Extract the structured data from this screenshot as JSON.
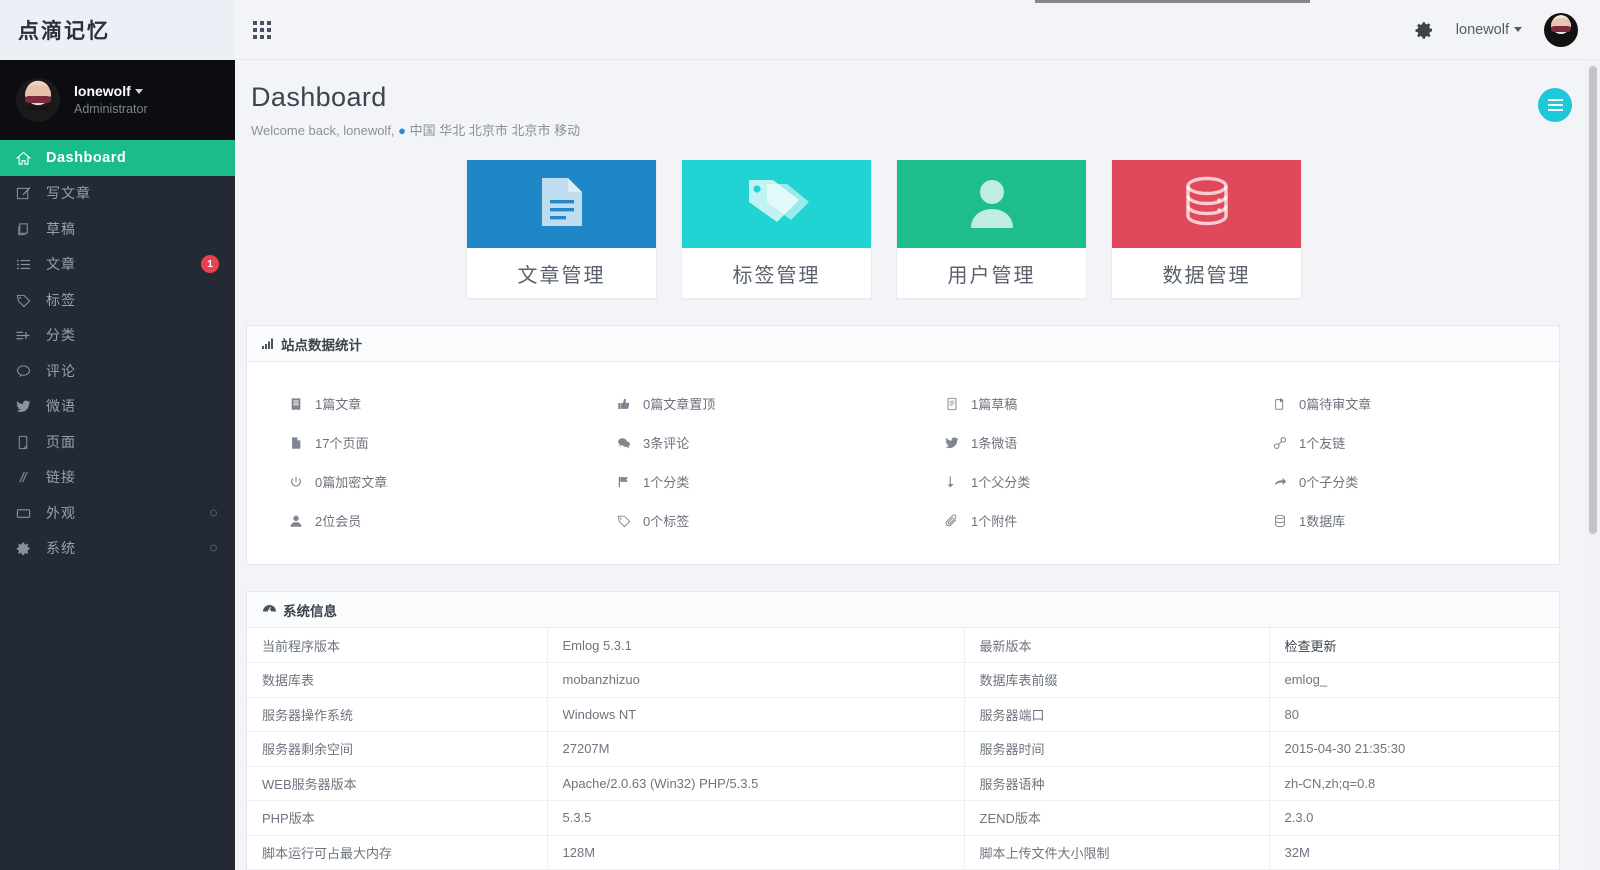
{
  "brand": {
    "title": "点滴记忆"
  },
  "sidebar": {
    "user": {
      "name": "lonewolf",
      "role": "Administrator",
      "avatar_icon": "user-avatar"
    },
    "items": [
      {
        "label": "Dashboard",
        "icon": "home-icon",
        "active": true,
        "badge": "",
        "dot": false
      },
      {
        "label": "写文章",
        "icon": "pencil-square-icon",
        "active": false,
        "badge": "",
        "dot": false
      },
      {
        "label": "草稿",
        "icon": "copy-icon",
        "active": false,
        "badge": "",
        "dot": false
      },
      {
        "label": "文章",
        "icon": "list-icon",
        "active": false,
        "badge": "1",
        "dot": false
      },
      {
        "label": "标签",
        "icon": "tag-icon",
        "active": false,
        "badge": "",
        "dot": false
      },
      {
        "label": "分类",
        "icon": "list-plus-icon",
        "active": false,
        "badge": "",
        "dot": false
      },
      {
        "label": "评论",
        "icon": "comment-icon",
        "active": false,
        "badge": "",
        "dot": false
      },
      {
        "label": "微语",
        "icon": "twitter-bird-icon",
        "active": false,
        "badge": "",
        "dot": false
      },
      {
        "label": "页面",
        "icon": "page-icon",
        "active": false,
        "badge": "",
        "dot": false
      },
      {
        "label": "链接",
        "icon": "link-slash-icon",
        "active": false,
        "badge": "",
        "dot": false
      },
      {
        "label": "外观",
        "icon": "window-icon",
        "active": false,
        "badge": "",
        "dot": true
      },
      {
        "label": "系统",
        "icon": "gear-icon",
        "active": false,
        "badge": "",
        "dot": true
      }
    ]
  },
  "topbar": {
    "apps_icon": "grid-apps-icon",
    "settings_icon": "gear-icon",
    "username": "lonewolf",
    "avatar_icon": "user-avatar"
  },
  "page": {
    "title": "Dashboard",
    "welcome_prefix": "Welcome back, lonewolf,",
    "location": "中国 华北 北京市 北京市 移动",
    "location_icon": "map-pin-icon",
    "fab_icon": "hamburger-icon"
  },
  "cards": [
    {
      "label": "文章管理",
      "icon": "document-icon",
      "color": "#1f86c8"
    },
    {
      "label": "标签管理",
      "icon": "tags-icon",
      "color": "#22d3d3"
    },
    {
      "label": "用户管理",
      "icon": "user-icon",
      "color": "#1fbd8c"
    },
    {
      "label": "数据管理",
      "icon": "database-icon",
      "color": "#e0495c"
    }
  ],
  "stats_panel": {
    "title": "站点数据统计",
    "title_icon": "bar-chart-icon",
    "items": [
      {
        "icon": "article-icon",
        "text": "1篇文章"
      },
      {
        "icon": "thumbs-up-icon",
        "text": "0篇文章置顶"
      },
      {
        "icon": "draft-icon",
        "text": "1篇草稿"
      },
      {
        "icon": "pending-icon",
        "text": "0篇待审文章"
      },
      {
        "icon": "file-icon",
        "text": "17个页面"
      },
      {
        "icon": "comments-icon",
        "text": "3条评论"
      },
      {
        "icon": "twitter-bird-icon",
        "text": "1条微语"
      },
      {
        "icon": "link-icon",
        "text": "1个友链"
      },
      {
        "icon": "power-icon",
        "text": "0篇加密文章"
      },
      {
        "icon": "flag-icon",
        "text": "1个分类"
      },
      {
        "icon": "level-down-icon",
        "text": "1个父分类"
      },
      {
        "icon": "arrow-right-icon",
        "text": "0个子分类"
      },
      {
        "icon": "user-icon",
        "text": "2位会员"
      },
      {
        "icon": "tag-icon",
        "text": "0个标签"
      },
      {
        "icon": "paperclip-icon",
        "text": "1个附件"
      },
      {
        "icon": "database-icon",
        "text": "1数据库"
      }
    ]
  },
  "system_panel": {
    "title": "系统信息",
    "title_icon": "dashboard-gauge-icon",
    "rows": [
      {
        "k1": "当前程序版本",
        "v1": "Emlog 5.3.1",
        "k2": "最新版本",
        "v2": "检查更新",
        "v2_link": true
      },
      {
        "k1": "数据库表",
        "v1": "mobanzhizuo",
        "k2": "数据库表前缀",
        "v2": "emlog_"
      },
      {
        "k1": "服务器操作系统",
        "v1": "Windows NT",
        "k2": "服务器端口",
        "v2": "80"
      },
      {
        "k1": "服务器剩余空间",
        "v1": "27207M",
        "k2": "服务器时间",
        "v2": "2015-04-30 21:35:30"
      },
      {
        "k1": "WEB服务器版本",
        "v1": "Apache/2.0.63 (Win32) PHP/5.3.5",
        "k2": "服务器语种",
        "v2": "zh-CN,zh;q=0.8"
      },
      {
        "k1": "PHP版本",
        "v1": "5.3.5",
        "k2": "ZEND版本",
        "v2": "2.3.0"
      },
      {
        "k1": "脚本运行可占最大内存",
        "v1": "128M",
        "k2": "脚本上传文件大小限制",
        "v2": "32M"
      }
    ]
  },
  "colors": {
    "sidebar_bg": "#232a34",
    "sidebar_user_bg": "#0b0d10",
    "active_green": "#1bbc8c",
    "badge_red": "#e8414f",
    "fab_cyan": "#1fc8d8",
    "page_bg": "#f2f4f8",
    "link_blue": "#2a8fd8"
  }
}
